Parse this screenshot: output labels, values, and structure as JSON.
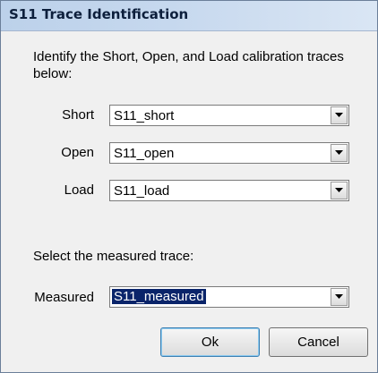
{
  "dialog": {
    "title": "S11 Trace Identification",
    "instructions": "Identify the Short, Open, and Load calibration traces below:",
    "rows": [
      {
        "label": "Short",
        "value": "S11_short"
      },
      {
        "label": "Open",
        "value": "S11_open"
      },
      {
        "label": "Load",
        "value": "S11_load"
      }
    ],
    "measured_section_label": "Select the measured trace:",
    "measured": {
      "label": "Measured",
      "value": "S11_measured"
    },
    "ok_label": "Ok",
    "cancel_label": "Cancel"
  },
  "icons": {
    "dropdown": "chevron-down-icon"
  }
}
